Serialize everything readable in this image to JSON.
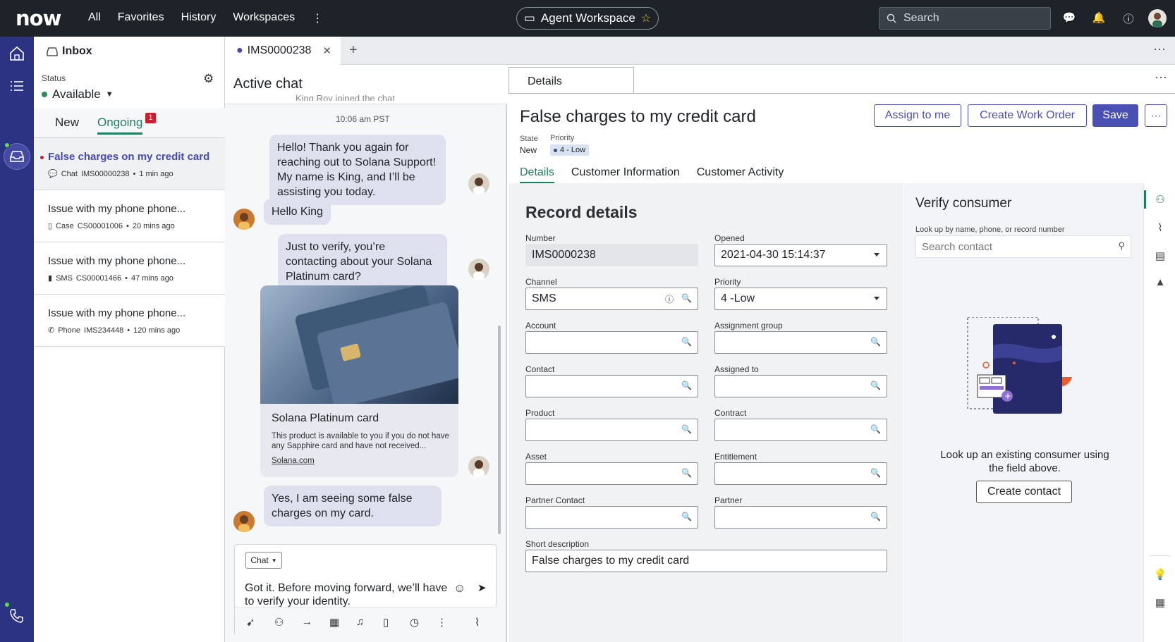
{
  "topbar": {
    "brand": "now",
    "nav": [
      "All",
      "Favorites",
      "History",
      "Workspaces"
    ],
    "workspace": "Agent Workspace",
    "search_placeholder": "Search"
  },
  "inbox": {
    "title": "Inbox",
    "status_label": "Status",
    "status_value": "Available",
    "tabs": [
      "New",
      "Ongoing"
    ],
    "ongoing_count": "1",
    "items": [
      {
        "title": "False charges on my credit card",
        "channel": "Chat",
        "id": "IMS00000238",
        "ago": "1 min ago",
        "icon": "chat-icon"
      },
      {
        "title": "Issue with my phone phone...",
        "channel": "Case",
        "id": "CS00001006",
        "ago": "20 mins ago",
        "icon": "case-icon"
      },
      {
        "title": "Issue with my phone phone...",
        "channel": "SMS",
        "id": "CS00001466",
        "ago": "47 mins ago",
        "icon": "sms-icon"
      },
      {
        "title": "Issue with my phone phone...",
        "channel": "Phone",
        "id": "IMS234448",
        "ago": "120 mins ago",
        "icon": "phone-icon"
      }
    ]
  },
  "doc_tab": {
    "label": "IMS0000238"
  },
  "chat": {
    "title": "Active chat",
    "joined_text": "King Roy joined the chat",
    "time": "10:06 am PST",
    "messages": [
      {
        "from": "agent",
        "text": "Hello! Thank you again for reaching out to Solana Support! My name is King, and I’ll be assisting you today."
      },
      {
        "from": "customer",
        "text": "Hello King"
      },
      {
        "from": "agent",
        "text": "Just to verify, you’re contacting about your Solana Platinum card?"
      },
      {
        "from": "customer",
        "text": "Yes, I am seeing some false charges on my card."
      }
    ],
    "card": {
      "title": "Solana Platinum card",
      "desc": "This product is available to you if you do not have any Sapphire card and have not received...",
      "link": "Solana.com"
    },
    "composer": {
      "mode": "Chat",
      "draft": "Got it. Before moving forward, we’ll have to verify your identity."
    }
  },
  "details": {
    "tab": "Details",
    "title": "False charges to my credit card",
    "buttons": {
      "assign": "Assign to me",
      "work_order": "Create Work Order",
      "save": "Save"
    },
    "state_label": "State",
    "state_value": "New",
    "priority_label": "Priority",
    "priority_value": "4 - Low",
    "subtabs": [
      "Details",
      "Customer Information",
      "Customer Activity"
    ],
    "section_title": "Record details",
    "fields": {
      "number": {
        "label": "Number",
        "value": "IMS0000238"
      },
      "opened": {
        "label": "Opened",
        "value": "2021-04-30 15:14:37"
      },
      "channel": {
        "label": "Channel",
        "value": "SMS"
      },
      "priority": {
        "label": "Priority",
        "value": "4 -Low"
      },
      "account": {
        "label": "Account",
        "value": ""
      },
      "assignment_group": {
        "label": "Assignment group",
        "value": ""
      },
      "contact": {
        "label": "Contact",
        "value": ""
      },
      "assigned_to": {
        "label": "Assigned to",
        "value": ""
      },
      "product": {
        "label": "Product",
        "value": ""
      },
      "contract": {
        "label": "Contract",
        "value": ""
      },
      "asset": {
        "label": "Asset",
        "value": ""
      },
      "entitlement": {
        "label": "Entitlement",
        "value": ""
      },
      "partner_contact": {
        "label": "Partner Contact",
        "value": ""
      },
      "partner": {
        "label": "Partner",
        "value": ""
      },
      "short_description": {
        "label": "Short description",
        "value": "False charges to my credit card"
      }
    }
  },
  "verify": {
    "title": "Verify consumer",
    "lookup_label": "Look up by name, phone, or record number",
    "search_placeholder": "Search contact",
    "message": "Look up an existing consumer using the field above.",
    "create_button": "Create contact"
  }
}
